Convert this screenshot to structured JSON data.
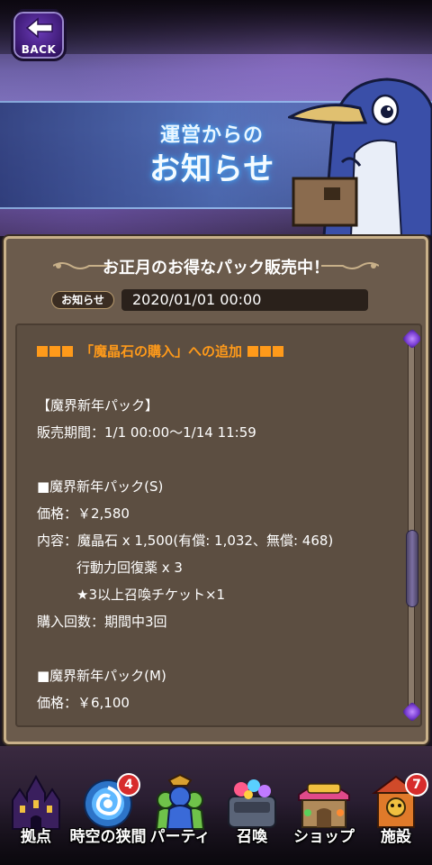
{
  "header": {
    "back_label": "BACK",
    "title_line1": "運営からの",
    "title_line2": "お知らせ"
  },
  "notice": {
    "title": "お正月のお得なパック販売中！",
    "tag": "お知らせ",
    "date": "2020/01/01 00:00",
    "lines": [
      {
        "text": "「魔晶石の購入」への追加",
        "style": "orange"
      },
      {
        "text": "",
        "style": "gap"
      },
      {
        "text": "【魔界新年パック】",
        "style": "normal"
      },
      {
        "text": "販売期間：1/1 00:00〜1/14 11:59",
        "style": "normal"
      },
      {
        "text": "",
        "style": "gap"
      },
      {
        "text": "■魔界新年パック(S)",
        "style": "normal"
      },
      {
        "text": "価格：￥2,580",
        "style": "normal"
      },
      {
        "text": "内容：魔晶石 x 1,500(有償: 1,032、無償: 468)",
        "style": "normal"
      },
      {
        "text": "行動力回復薬 x 3",
        "style": "indent"
      },
      {
        "text": "★3以上召喚チケット×1",
        "style": "indent"
      },
      {
        "text": "購入回数：期間中3回",
        "style": "normal"
      },
      {
        "text": "",
        "style": "gap"
      },
      {
        "text": "■魔界新年パック(M)",
        "style": "normal"
      },
      {
        "text": "価格：￥6,100",
        "style": "normal"
      }
    ]
  },
  "nav": {
    "items": [
      {
        "label": "拠点",
        "icon": "castle-icon",
        "badge": ""
      },
      {
        "label": "時空の狭間",
        "icon": "portal-icon",
        "badge": "4"
      },
      {
        "label": "パーティ",
        "icon": "party-icon",
        "badge": ""
      },
      {
        "label": "召喚",
        "icon": "summon-icon",
        "badge": ""
      },
      {
        "label": "ショップ",
        "icon": "shop-icon",
        "badge": ""
      },
      {
        "label": "施設",
        "icon": "facility-icon",
        "badge": "7"
      }
    ]
  },
  "colors": {
    "accent_orange": "#ff9a1a",
    "panel_bg": "#6b5b4c",
    "panel_border": "#c8b089",
    "badge_red": "#d72c2c"
  }
}
